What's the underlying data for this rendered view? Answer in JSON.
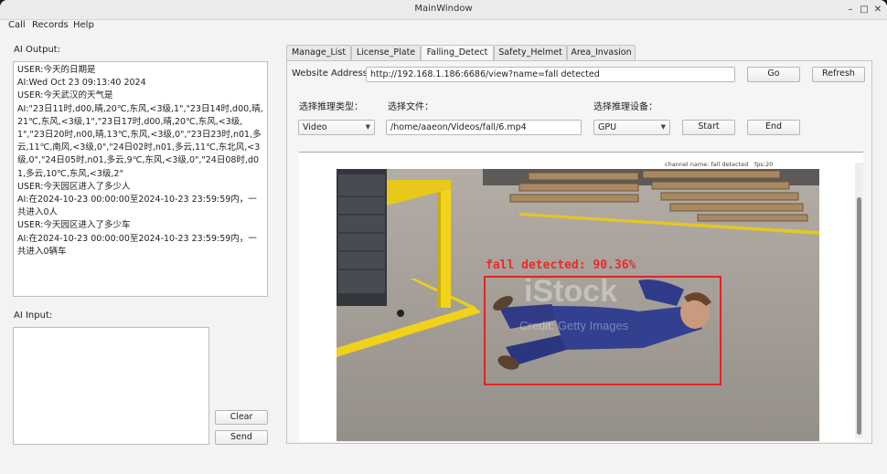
{
  "window": {
    "title": "MainWindow",
    "min": "–",
    "max": "□",
    "close": "✕"
  },
  "menu": {
    "items": [
      "Call",
      "Records",
      "Help"
    ]
  },
  "left": {
    "output_label": "AI Output:",
    "output_lines": [
      "USER:今天的日期是",
      "AI:Wed Oct 23 09:13:40 2024",
      "USER:今天武汉的天气是",
      "AI:\"23日11时,d00,晴,20℃,东风,<3级,1\",\"23日14时,d00,晴,21℃,东风,<3级,1\",\"23日17时,d00,晴,20℃,东风,<3级,1\",\"23日20时,n00,晴,13℃,东风,<3级,0\",\"23日23时,n01,多云,11℃,南风,<3级,0\",\"24日02时,n01,多云,11℃,东北风,<3级,0\",\"24日05时,n01,多云,9℃,东风,<3级,0\",\"24日08时,d01,多云,10℃,东风,<3级,2\"",
      "USER:今天园区进入了多少人",
      "AI:在2024-10-23 00:00:00至2024-10-23 23:59:59内，一共进入0人",
      "USER:今天园区进入了多少车",
      "AI:在2024-10-23 00:00:00至2024-10-23 23:59:59内，一共进入0辆车"
    ],
    "input_label": "AI Input:",
    "input_value": "",
    "clear_label": "Clear",
    "send_label": "Send"
  },
  "tabs": [
    "Manage_List",
    "License_Plate",
    "Falling_Detect",
    "Safety_Helmet",
    "Area_Invasion"
  ],
  "active_tab": "Falling_Detect",
  "form": {
    "website_label": "Website Address:",
    "website_value": "http://192.168.1.186:6686/view?name=fall detected",
    "go_label": "Go",
    "refresh_label": "Refresh",
    "infer_type_label": "选择推理类型：",
    "file_label": "选择文件：",
    "device_label": "选择推理设备：",
    "infer_type_value": "Video",
    "file_value": "/home/aaeon/Videos/fall/6.mp4",
    "device_value": "GPU",
    "start_label": "Start",
    "end_label": "End"
  },
  "stream": {
    "channel_text": "channel name: fall detected",
    "fps_text": "fps:20",
    "detection_label": "fall detected: 90.36%",
    "watermark_brand": "iStock",
    "watermark_credit": "Credit: Getty Images"
  },
  "colors": {
    "detection": "#e52222",
    "safety_line": "#f0d21a"
  }
}
